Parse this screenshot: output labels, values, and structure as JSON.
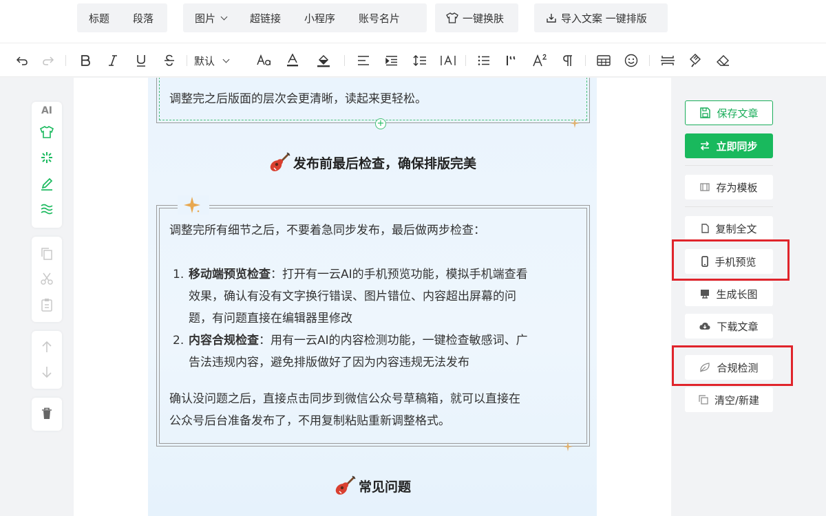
{
  "menu": {
    "group1": [
      "标题",
      "段落"
    ],
    "group2": [
      "图片",
      "超链接",
      "小程序",
      "账号名片"
    ],
    "skin": "一键换肤",
    "import": "导入文案 一键排版"
  },
  "toolbar": {
    "font": "默认",
    "icons": [
      "undo-icon",
      "redo-icon",
      "bold-icon",
      "italic-icon",
      "underline-icon",
      "strikethrough-icon",
      "font-size-icon",
      "font-color-icon",
      "highlight-icon",
      "align-left-icon",
      "indent-icon",
      "line-height-icon",
      "letter-spacing-icon",
      "list-icon",
      "quote-icon",
      "superscript-icon",
      "paragraph-icon",
      "table-icon",
      "emoji-icon",
      "divider-icon",
      "format-painter-icon",
      "eraser-icon"
    ]
  },
  "left_tools": {
    "ai_label": "AI"
  },
  "article": {
    "prev_para": "调整完之后版面的层次会更清晰，读起来更轻松。",
    "heading1": "发布前最后检查，确保排版完美",
    "intro": "调整完所有细节之后，不要着急同步发布，最后做两步检查：",
    "steps": [
      {
        "num": "1.",
        "bold": "移动端预览检查",
        "text_lines": [
          "：打开有一云AI的手机预览功能，模拟手机端查看",
          "效果，确认有没有文字换行错误、图片错位、内容超出屏幕的问",
          "题，有问题直接在编辑器里修改"
        ]
      },
      {
        "num": "2.",
        "bold": "内容合规检查",
        "text_lines": [
          "：用有一云AI的内容检测功能，一键检查敏感词、广",
          "告法违规内容，避免排版做好了因为内容违规无法发布"
        ]
      }
    ],
    "outro_lines": [
      "确认没问题之后，直接点击同步到微信公众号草稿箱，就可以直接在",
      "公众号后台准备发布了，不用复制粘贴重新调整格式。"
    ],
    "heading2": "常见问题"
  },
  "right_panel": {
    "save": "保存文章",
    "sync": "立即同步",
    "template": "存为模板",
    "copy": "复制全文",
    "preview": "手机预览",
    "longimg": "生成长图",
    "download": "下载文章",
    "compliance": "合规检测",
    "clear": "清空/新建"
  },
  "colors": {
    "accent_green": "#19b95d",
    "highlight_red": "#e0242b",
    "article_bg": "#eaf4fd"
  }
}
